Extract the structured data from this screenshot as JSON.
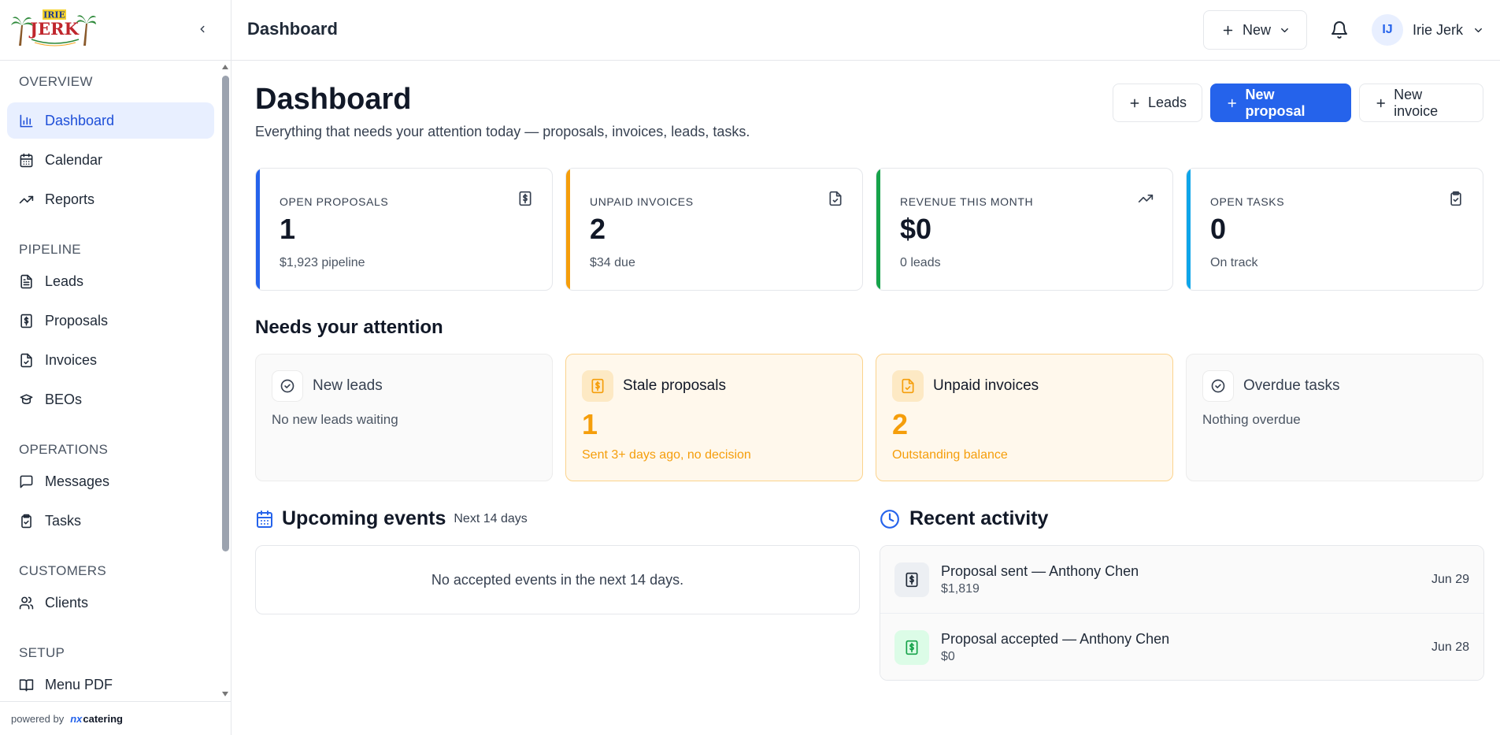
{
  "brand": {
    "logo_top": "IRIE",
    "logo_main": "JERK",
    "powered_by": "powered by",
    "platform": "nxcatering",
    "platform_prefix": "nx",
    "platform_suffix": "catering"
  },
  "sidebar": {
    "sections": [
      {
        "label": "OVERVIEW",
        "items": [
          {
            "label": "Dashboard",
            "icon": "bar-chart-icon",
            "active": true
          },
          {
            "label": "Calendar",
            "icon": "calendar-icon"
          },
          {
            "label": "Reports",
            "icon": "trending-up-icon"
          }
        ]
      },
      {
        "label": "PIPELINE",
        "items": [
          {
            "label": "Leads",
            "icon": "file-text-icon"
          },
          {
            "label": "Proposals",
            "icon": "dollar-doc-icon"
          },
          {
            "label": "Invoices",
            "icon": "file-check-icon"
          },
          {
            "label": "BEOs",
            "icon": "chef-hat-icon"
          }
        ]
      },
      {
        "label": "OPERATIONS",
        "items": [
          {
            "label": "Messages",
            "icon": "message-icon"
          },
          {
            "label": "Tasks",
            "icon": "clipboard-check-icon"
          }
        ]
      },
      {
        "label": "CUSTOMERS",
        "items": [
          {
            "label": "Clients",
            "icon": "users-icon"
          }
        ]
      },
      {
        "label": "SETUP",
        "items": [
          {
            "label": "Menu PDF",
            "icon": "book-icon"
          }
        ]
      }
    ]
  },
  "topbar": {
    "title": "Dashboard",
    "new_label": "New",
    "user_initials": "IJ",
    "user_name": "Irie Jerk"
  },
  "page": {
    "title": "Dashboard",
    "subtitle": "Everything that needs your attention today — proposals, invoices, leads, tasks.",
    "actions": {
      "leads": "Leads",
      "new_proposal": "New proposal",
      "new_invoice": "New invoice"
    }
  },
  "stats": [
    {
      "label": "OPEN PROPOSALS",
      "value": "1",
      "sub": "$1,923 pipeline",
      "accent": "#2563eb",
      "icon": "dollar-doc-icon"
    },
    {
      "label": "UNPAID INVOICES",
      "value": "2",
      "sub": "$34 due",
      "accent": "#f59e0b",
      "icon": "file-check-icon"
    },
    {
      "label": "REVENUE THIS MONTH",
      "value": "$0",
      "sub": "0 leads",
      "accent": "#16a34a",
      "icon": "trending-up-icon"
    },
    {
      "label": "OPEN TASKS",
      "value": "0",
      "sub": "On track",
      "accent": "#0ea5e9",
      "icon": "clipboard-check-icon"
    }
  ],
  "attention": {
    "title": "Needs your attention",
    "cards": [
      {
        "title": "New leads",
        "empty": "No new leads waiting"
      },
      {
        "title": "Stale proposals",
        "count": "1",
        "sub": "Sent 3+ days ago, no decision"
      },
      {
        "title": "Unpaid invoices",
        "count": "2",
        "sub": "Outstanding balance"
      },
      {
        "title": "Overdue tasks",
        "empty": "Nothing overdue"
      }
    ]
  },
  "upcoming": {
    "title": "Upcoming events",
    "range": "Next 14 days",
    "empty": "No accepted events in the next 14 days."
  },
  "recent": {
    "title": "Recent activity",
    "items": [
      {
        "title": "Proposal sent — Anthony Chen",
        "amount": "$1,819",
        "date": "Jun 29"
      },
      {
        "title": "Proposal accepted — Anthony Chen",
        "amount": "$0",
        "date": "Jun 28"
      }
    ]
  },
  "colors": {
    "primary": "#2563eb",
    "warning": "#f59e0b",
    "success": "#16a34a",
    "info": "#0ea5e9"
  }
}
